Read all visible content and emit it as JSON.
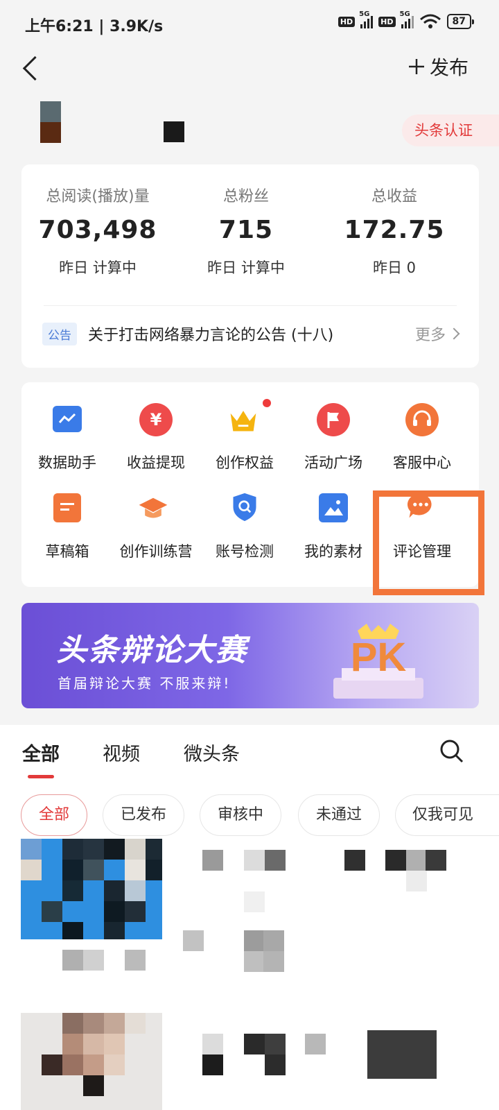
{
  "status": {
    "time": "上午6:21 | 3.9K/s",
    "hd1": "HD",
    "sig1": "5G",
    "hd2": "HD",
    "sig2": "5G",
    "battery": "87"
  },
  "topbar": {
    "publish": "发布"
  },
  "profile": {
    "badge": "头条认证"
  },
  "stats": [
    {
      "label": "总阅读(播放)量",
      "value": "703,498",
      "sub": "昨日 计算中"
    },
    {
      "label": "总粉丝",
      "value": "715",
      "sub": "昨日 计算中"
    },
    {
      "label": "总收益",
      "value": "172.75",
      "sub": "昨日 0"
    }
  ],
  "notice": {
    "tag": "公告",
    "text": "关于打击网络暴力言论的公告 (十八)",
    "more": "更多"
  },
  "tools": [
    {
      "label": "数据助手",
      "icon": "data-chart-icon",
      "color": "#3a7be8"
    },
    {
      "label": "收益提现",
      "icon": "yen-icon",
      "color": "#ee4b4b"
    },
    {
      "label": "创作权益",
      "icon": "crown-icon",
      "color": "#f5b40f"
    },
    {
      "label": "活动广场",
      "icon": "flag-icon",
      "color": "#ee4b4b"
    },
    {
      "label": "客服中心",
      "icon": "headset-icon",
      "color": "#f2753a"
    },
    {
      "label": "草稿箱",
      "icon": "draft-icon",
      "color": "#f2753a"
    },
    {
      "label": "创作训练营",
      "icon": "graduation-cap-icon",
      "color": "#f2753a"
    },
    {
      "label": "账号检测",
      "icon": "shield-search-icon",
      "color": "#3a7be8"
    },
    {
      "label": "我的素材",
      "icon": "image-icon",
      "color": "#3a7be8"
    },
    {
      "label": "评论管理",
      "icon": "comment-icon",
      "color": "#f2753a"
    }
  ],
  "banner": {
    "title": "头条辩论大赛",
    "subtitle": "首届辩论大赛 不服来辩!",
    "pk": "PK"
  },
  "tabs": [
    "全部",
    "视频",
    "微头条"
  ],
  "chips": [
    "全部",
    "已发布",
    "审核中",
    "未通过",
    "仅我可见"
  ],
  "colors": {
    "accent": "#e23a3a",
    "highlight": "#f2753a"
  }
}
